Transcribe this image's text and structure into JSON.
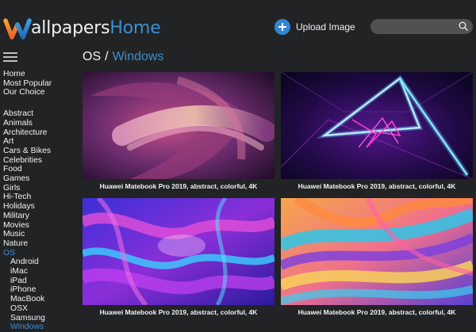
{
  "header": {
    "logo_part1": "allpapers",
    "logo_part2": "Home",
    "upload_label": "Upload Image",
    "search_placeholder": ""
  },
  "colors": {
    "background": "#222325",
    "accent": "#3c8fd3",
    "upload_button": "#2f86d9",
    "search_bg": "#505153"
  },
  "sidebar": {
    "primary": [
      "Home",
      "Most Popular",
      "Our Choice"
    ],
    "categories": [
      {
        "label": "Abstract"
      },
      {
        "label": "Animals"
      },
      {
        "label": "Architecture"
      },
      {
        "label": "Art"
      },
      {
        "label": "Cars & Bikes"
      },
      {
        "label": "Celebrities"
      },
      {
        "label": "Food"
      },
      {
        "label": "Games"
      },
      {
        "label": "Girls"
      },
      {
        "label": "Hi-Tech"
      },
      {
        "label": "Holidays"
      },
      {
        "label": "Military"
      },
      {
        "label": "Movies"
      },
      {
        "label": "Music"
      },
      {
        "label": "Nature"
      },
      {
        "label": "OS",
        "active": true
      }
    ],
    "os_sub": [
      {
        "label": "Android"
      },
      {
        "label": "iMac"
      },
      {
        "label": "iPad"
      },
      {
        "label": "iPhone"
      },
      {
        "label": "MacBook"
      },
      {
        "label": "OSX"
      },
      {
        "label": "Samsung"
      },
      {
        "label": "Windows",
        "active": true
      }
    ]
  },
  "main": {
    "breadcrumb_parent": "OS",
    "breadcrumb_separator": "/",
    "breadcrumb_current": "Windows",
    "cards": [
      {
        "caption": "Huawei Matebook Pro 2019, abstract, colorful, 4K"
      },
      {
        "caption": "Huawei Matebook Pro 2019, abstract, colorful, 4K"
      },
      {
        "caption": "Huawei Matebook Pro 2019, abstract, colorful, 4K"
      },
      {
        "caption": "Huawei Matebook Pro 2019, abstract, colorful, 4K"
      }
    ]
  }
}
